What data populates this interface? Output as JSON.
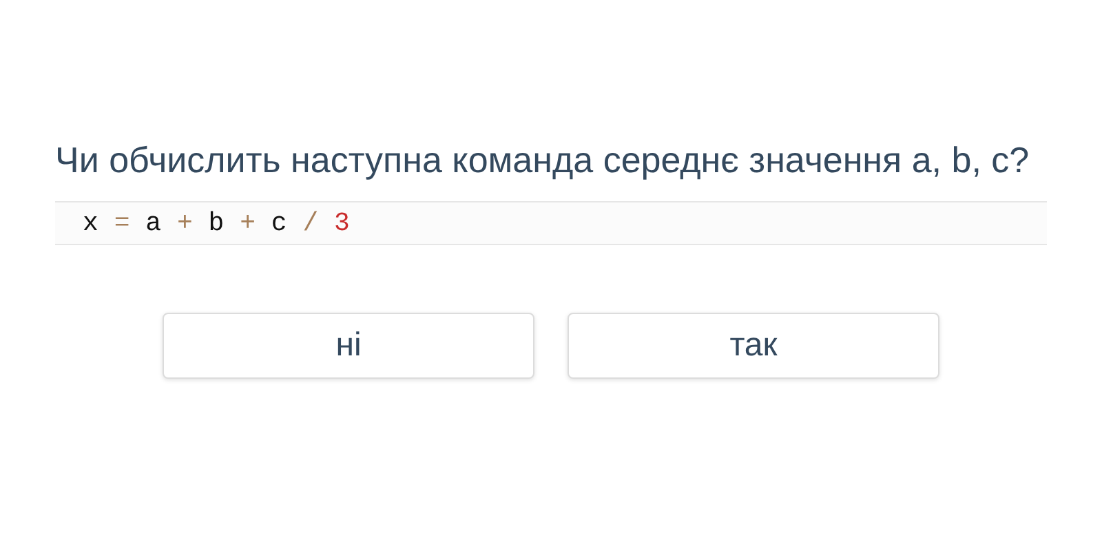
{
  "question": "Чи обчислить наступна команда середнє значення a, b, c?",
  "code": [
    {
      "text": "x",
      "kind": "var"
    },
    {
      "text": "=",
      "kind": "op"
    },
    {
      "text": "a",
      "kind": "var"
    },
    {
      "text": "+",
      "kind": "op"
    },
    {
      "text": "b",
      "kind": "var"
    },
    {
      "text": "+",
      "kind": "op"
    },
    {
      "text": "c",
      "kind": "var"
    },
    {
      "text": "/",
      "kind": "op"
    },
    {
      "text": "3",
      "kind": "num"
    }
  ],
  "buttons": [
    {
      "label": "ні"
    },
    {
      "label": "так"
    }
  ]
}
